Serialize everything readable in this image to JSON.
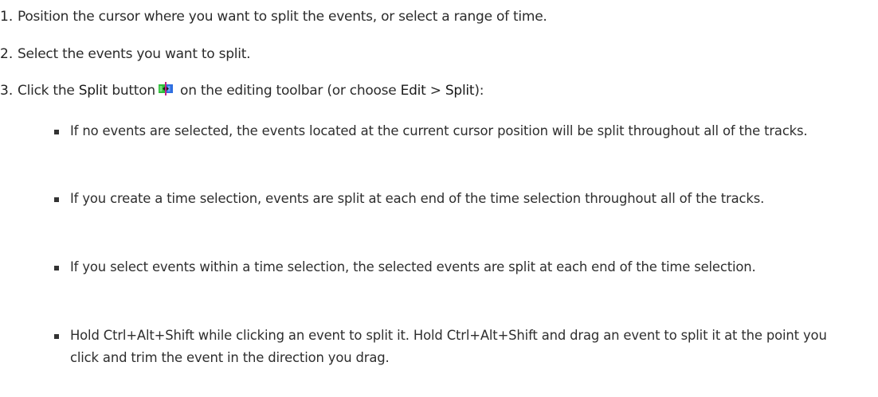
{
  "steps": [
    {
      "number": "1.",
      "text": "Position the cursor where you want to split the events, or select a range of time."
    },
    {
      "number": "2.",
      "text": "Select the events you want to split."
    },
    {
      "number": "3.",
      "part1": "Click the ",
      "split_word": "Split",
      "part2": " button",
      "icon": "split-icon",
      "part3": " on the editing toolbar (or choose ",
      "edit_word": "Edit",
      "separator": " > ",
      "split_word2": "Split",
      "part4": "):"
    }
  ],
  "bullets": [
    "If no events are selected, the events located at the current cursor position will be split throughout all of the tracks.",
    "If you create a time selection, events are split at each end of the time selection throughout all of the tracks.",
    "If you select events within a time selection, the selected events are split at each end of the time selection.",
    "Hold Ctrl+Alt+Shift while clicking an event to split it. Hold Ctrl+Alt+Shift and drag an event to split it at the point you click and trim the event in the direction you drag."
  ],
  "colors": {
    "icon_green": "#2fbf3a",
    "icon_blue": "#2f6fe0",
    "icon_divider": "#c0208a"
  }
}
